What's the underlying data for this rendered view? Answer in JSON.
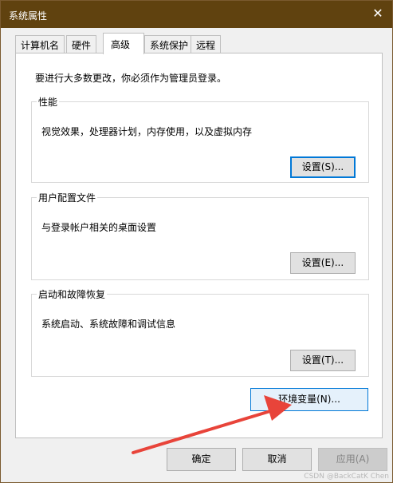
{
  "window": {
    "title": "系统属性",
    "close_glyph": "✕"
  },
  "tabs": [
    {
      "label": "计算机名"
    },
    {
      "label": "硬件"
    },
    {
      "label": "高级",
      "active": true
    },
    {
      "label": "系统保护"
    },
    {
      "label": "远程"
    }
  ],
  "advanced": {
    "notice": "要进行大多数更改，你必须作为管理员登录。",
    "performance": {
      "title": "性能",
      "description": "视觉效果，处理器计划，内存使用，以及虚拟内存",
      "settings_label": "设置(S)..."
    },
    "profiles": {
      "title": "用户配置文件",
      "description": "与登录帐户相关的桌面设置",
      "settings_label": "设置(E)..."
    },
    "startup": {
      "title": "启动和故障恢复",
      "description": "系统启动、系统故障和调试信息",
      "settings_label": "设置(T)..."
    },
    "env_label": "环境变量(N)..."
  },
  "footer": {
    "ok_label": "确定",
    "cancel_label": "取消",
    "apply_label": "应用(A)"
  },
  "annotation": {
    "arrow_color": "#e8443a"
  },
  "watermark": "CSDN @BackCatK Chen",
  "colors": {
    "titlebar": "#60420f",
    "focus_blue": "#0078d7"
  }
}
